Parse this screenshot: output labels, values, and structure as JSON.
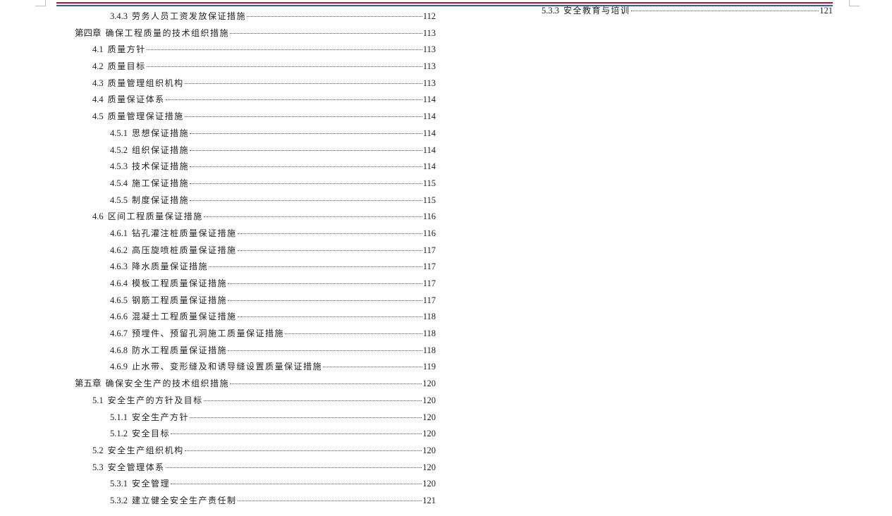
{
  "colors": {
    "rule_red": "#c8102e",
    "rule_blue": "#2f5fb3",
    "text": "#222222"
  },
  "toc_left": [
    {
      "num": "3.4.3",
      "title": "劳务人员工资发放保证措施",
      "page": "112",
      "level": 3
    },
    {
      "num": "第四章",
      "title": "确保工程质量的技术组织措施",
      "page": "113",
      "level": 1
    },
    {
      "num": "4.1",
      "title": "质量方针",
      "page": "113",
      "level": 2
    },
    {
      "num": "4.2",
      "title": "质量目标",
      "page": "113",
      "level": 2
    },
    {
      "num": "4.3",
      "title": "质量管理组织机构",
      "page": "113",
      "level": 2
    },
    {
      "num": "4.4",
      "title": "质量保证体系",
      "page": "114",
      "level": 2
    },
    {
      "num": "4.5",
      "title": "质量管理保证措施",
      "page": "114",
      "level": 2
    },
    {
      "num": "4.5.1",
      "title": "思想保证措施",
      "page": "114",
      "level": 3
    },
    {
      "num": "4.5.2",
      "title": "组织保证措施",
      "page": "114",
      "level": 3
    },
    {
      "num": "4.5.3",
      "title": "技术保证措施",
      "page": "114",
      "level": 3
    },
    {
      "num": "4.5.4",
      "title": "施工保证措施",
      "page": "115",
      "level": 3
    },
    {
      "num": "4.5.5",
      "title": "制度保证措施",
      "page": "115",
      "level": 3
    },
    {
      "num": "4.6",
      "title": "区间工程质量保证措施",
      "page": "116",
      "level": 2
    },
    {
      "num": "4.6.1",
      "title": "钻孔灌注桩质量保证措施",
      "page": "116",
      "level": 3
    },
    {
      "num": "4.6.2",
      "title": "高压旋喷桩质量保证措施",
      "page": "117",
      "level": 3
    },
    {
      "num": "4.6.3",
      "title": "降水质量保证措施",
      "page": "117",
      "level": 3
    },
    {
      "num": "4.6.4",
      "title": "模板工程质量保证措施",
      "page": "117",
      "level": 3
    },
    {
      "num": "4.6.5",
      "title": "钢筋工程质量保证措施",
      "page": "117",
      "level": 3
    },
    {
      "num": "4.6.6",
      "title": "混凝土工程质量保证措施",
      "page": "118",
      "level": 3
    },
    {
      "num": "4.6.7",
      "title": "预埋件、预留孔洞施工质量保证措施",
      "page": "118",
      "level": 3
    },
    {
      "num": "4.6.8",
      "title": "防水工程质量保证措施",
      "page": "118",
      "level": 3
    },
    {
      "num": "4.6.9",
      "title": "止水带、变形缝及和诱导缝设置质量保证措施",
      "page": "119",
      "level": 3
    },
    {
      "num": "第五章",
      "title": "确保安全生产的技术组织措施",
      "page": "120",
      "level": 1
    },
    {
      "num": "5.1",
      "title": "安全生产的方针及目标",
      "page": "120",
      "level": 2
    },
    {
      "num": "5.1.1",
      "title": "安全生产方针",
      "page": "120",
      "level": 3
    },
    {
      "num": "5.1.2",
      "title": "安全目标",
      "page": "120",
      "level": 3
    },
    {
      "num": "5.2",
      "title": "安全生产组织机构",
      "page": "120",
      "level": 2
    },
    {
      "num": "5.3",
      "title": "安全管理体系",
      "page": "120",
      "level": 2
    },
    {
      "num": "5.3.1",
      "title": "安全管理",
      "page": "120",
      "level": 3
    },
    {
      "num": "5.3.2",
      "title": "建立健全安全生产责任制",
      "page": "121",
      "level": 3
    }
  ],
  "toc_right": [
    {
      "num": "5.3.3",
      "title": "安全教育与培训",
      "page": "121",
      "level": 3
    }
  ]
}
